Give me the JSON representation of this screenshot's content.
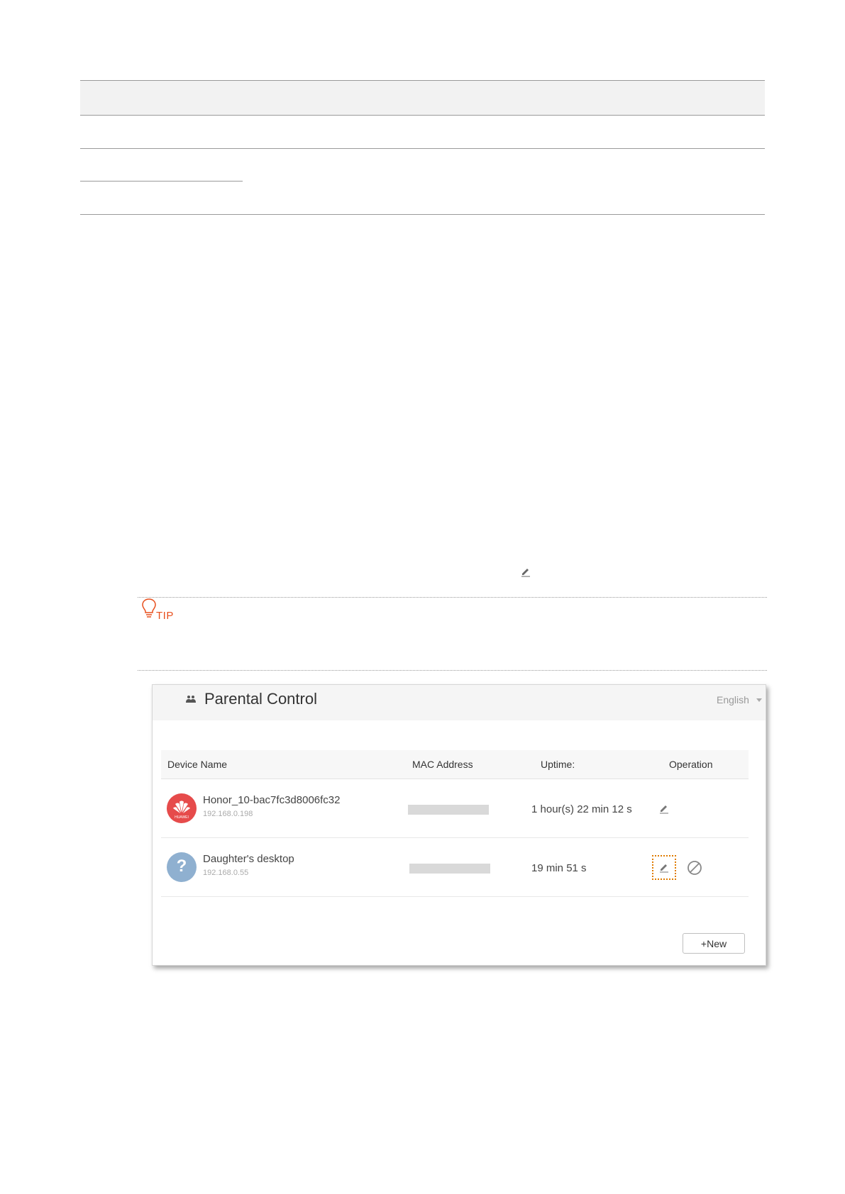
{
  "tip": {
    "label": "TIP"
  },
  "app": {
    "title": "Parental Control",
    "language": "English",
    "icons": {
      "family": "family-icon",
      "language_caret": "chevron-down-icon"
    }
  },
  "table": {
    "headers": [
      "Device Name",
      "MAC Address",
      "Uptime:",
      "Operation"
    ],
    "rows": [
      {
        "device_name": "Honor_10-bac7fc3d8006fc32",
        "ip": "192.168.0.198",
        "avatar": "huawei-logo",
        "avatar_label": "HUAWEI",
        "mac_address": "",
        "uptime": "1 hour(s) 22 min 12 s",
        "operations": [
          "edit-icon"
        ]
      },
      {
        "device_name": "Daughter's desktop",
        "ip": "192.168.0.55",
        "avatar": "question-mark",
        "avatar_label": "?",
        "mac_address": "",
        "uptime": "19 min 51 s",
        "operations": [
          "edit-icon",
          "block-icon"
        ],
        "highlighted_operation": "edit-icon"
      }
    ]
  },
  "actions": {
    "new_label": "+New"
  },
  "colors": {
    "tip": "#e8501e",
    "huawei_red": "#e64b4b",
    "unknown_avatar": "#8fb0d0",
    "highlight": "#e07b00"
  }
}
